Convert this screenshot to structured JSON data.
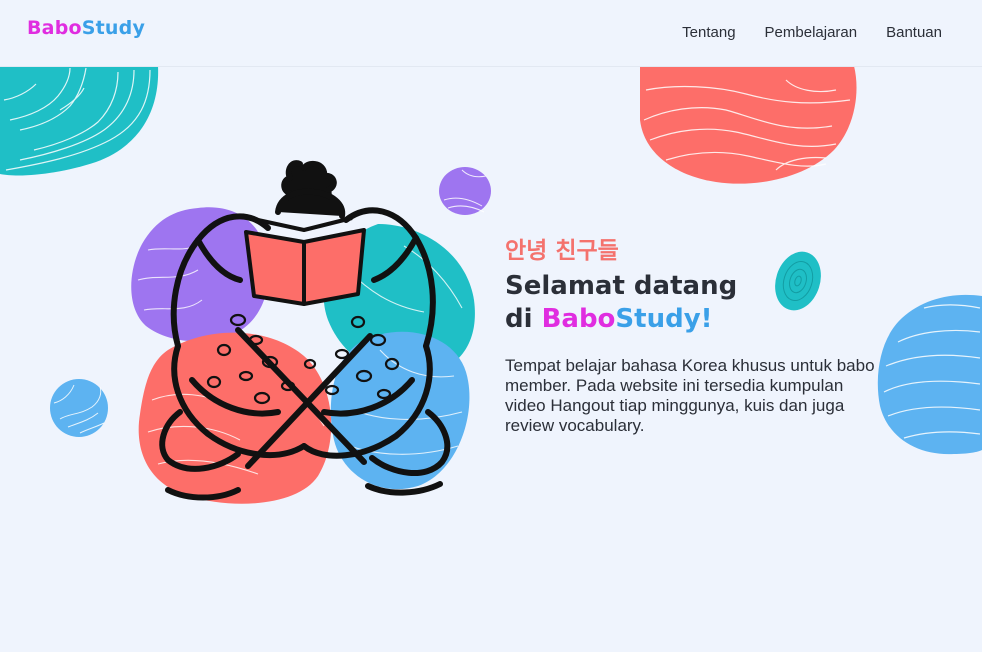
{
  "brand": {
    "part1": "Babo",
    "part2": "Study",
    "part1_color": "#e02de0",
    "part2_color": "#3aa0e8"
  },
  "nav": {
    "items": [
      {
        "label": "Tentang"
      },
      {
        "label": "Pembelajaran"
      },
      {
        "label": "Bantuan"
      }
    ]
  },
  "hero": {
    "greeting": "안녕 친구들",
    "title_line1": "Selamat datang",
    "title_line2_prefix": "di ",
    "brand_part1": "Babo",
    "brand_part2": "Study",
    "brand_suffix": "!",
    "description": "Tempat belajar bahasa Korea khusus untuk babo member. Pada website ini tersedia kumpulan video Hangout tiap minggunya, kuis dan juga review vocabulary."
  },
  "colors": {
    "background": "#eff4fd",
    "teal": "#1fbfc6",
    "coral": "#fd6e69",
    "purple": "#9e75f0",
    "blue": "#5db3f1",
    "text": "#2b2f38",
    "greeting": "#f4726d"
  },
  "icons": {
    "illustration": "person-reading-book-illustration"
  }
}
